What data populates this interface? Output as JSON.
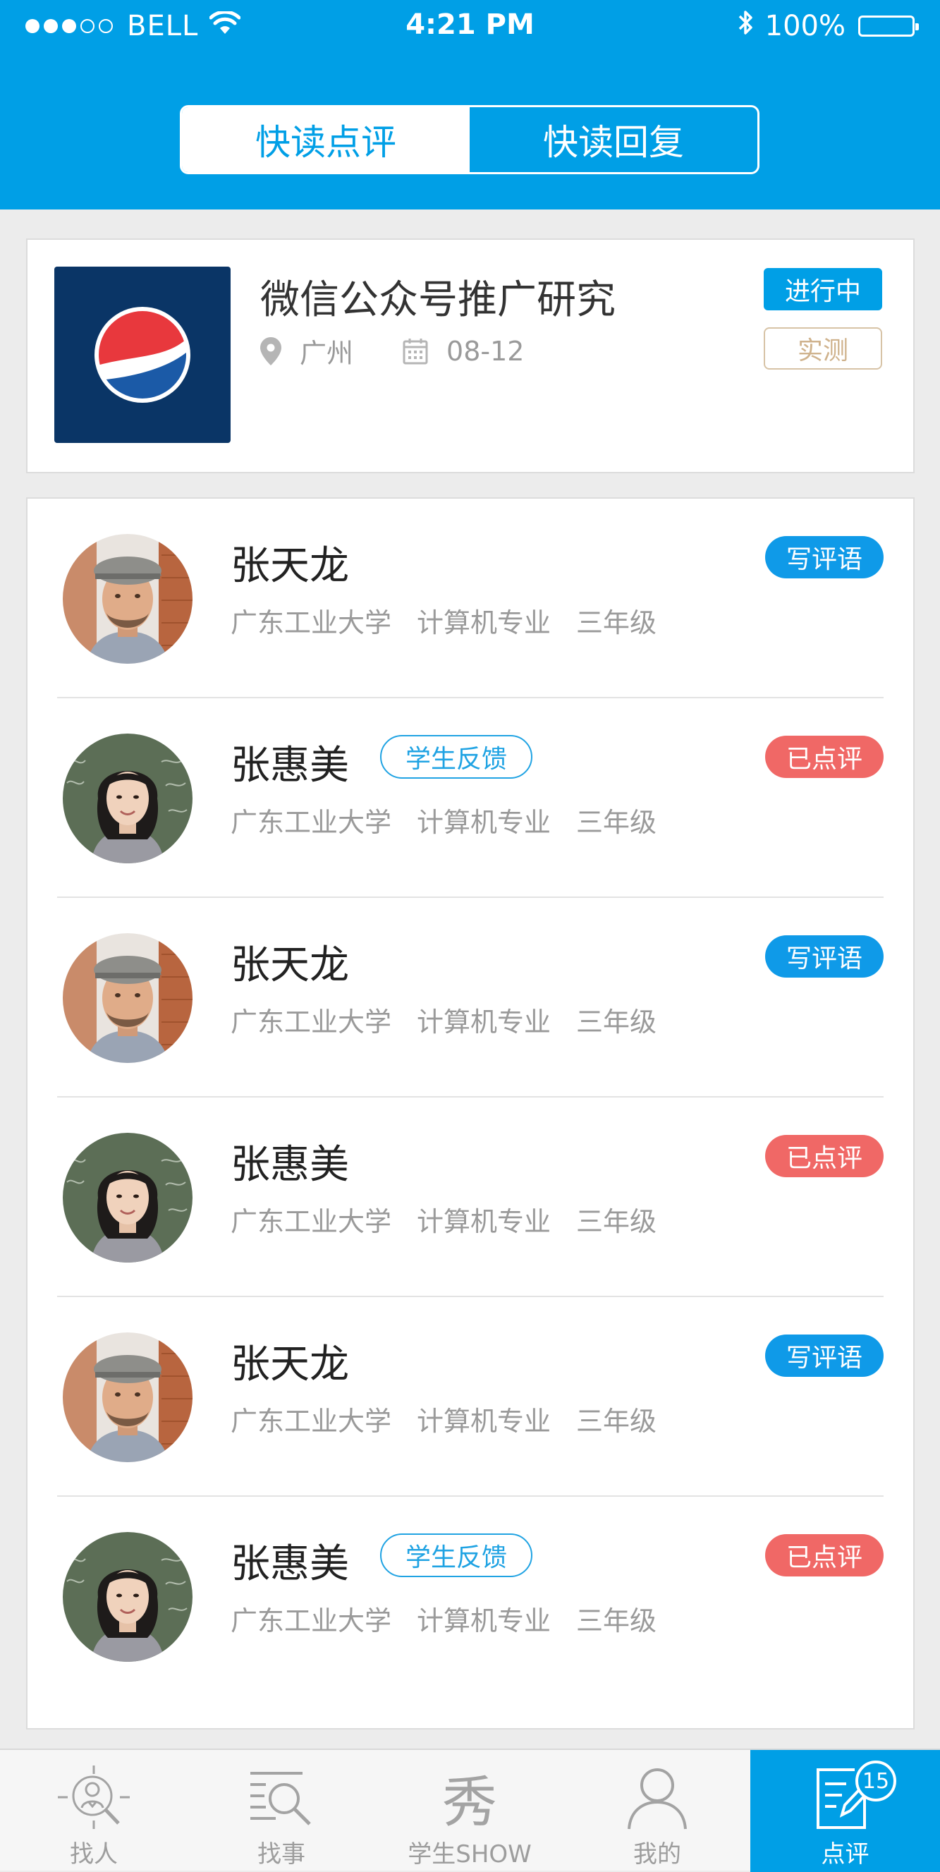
{
  "status_bar": {
    "carrier": "BELL",
    "time": "4:21 PM",
    "battery": "100%",
    "signal_bars_filled": 3,
    "signal_bars_total": 5
  },
  "segment": {
    "tabs": [
      {
        "label": "快读点评",
        "active": true
      },
      {
        "label": "快读回复",
        "active": false
      }
    ]
  },
  "project": {
    "title": "微信公众号推广研究",
    "location": "广州",
    "date": "08-12",
    "status": "进行中",
    "type": "实测"
  },
  "students": [
    {
      "name": "张天龙",
      "school": "广东工业大学",
      "major": "计算机专业",
      "grade": "三年级",
      "feedback": "",
      "action": "写评语",
      "action_type": "write",
      "avatar": "male"
    },
    {
      "name": "张惠美",
      "school": "广东工业大学",
      "major": "计算机专业",
      "grade": "三年级",
      "feedback": "学生反馈",
      "action": "已点评",
      "action_type": "done",
      "avatar": "female"
    },
    {
      "name": "张天龙",
      "school": "广东工业大学",
      "major": "计算机专业",
      "grade": "三年级",
      "feedback": "",
      "action": "写评语",
      "action_type": "write",
      "avatar": "male"
    },
    {
      "name": "张惠美",
      "school": "广东工业大学",
      "major": "计算机专业",
      "grade": "三年级",
      "feedback": "",
      "action": "已点评",
      "action_type": "done",
      "avatar": "female"
    },
    {
      "name": "张天龙",
      "school": "广东工业大学",
      "major": "计算机专业",
      "grade": "三年级",
      "feedback": "",
      "action": "写评语",
      "action_type": "write",
      "avatar": "male"
    },
    {
      "name": "张惠美",
      "school": "广东工业大学",
      "major": "计算机专业",
      "grade": "三年级",
      "feedback": "学生反馈",
      "action": "已点评",
      "action_type": "done",
      "avatar": "female"
    }
  ],
  "tabbar": {
    "items": [
      {
        "label": "找人",
        "icon": "find-person-icon",
        "active": false
      },
      {
        "label": "找事",
        "icon": "find-task-icon",
        "active": false
      },
      {
        "label": "学生SHOW",
        "icon": "show-icon",
        "glyph": "秀",
        "active": false
      },
      {
        "label": "我的",
        "icon": "profile-icon",
        "active": false
      },
      {
        "label": "点评",
        "icon": "review-icon",
        "active": true,
        "badge": "15"
      }
    ]
  },
  "colors": {
    "primary": "#009fe6",
    "write_button": "#0f9ae8",
    "reviewed_button": "#f06866",
    "type_badge": "#cfb28c"
  }
}
